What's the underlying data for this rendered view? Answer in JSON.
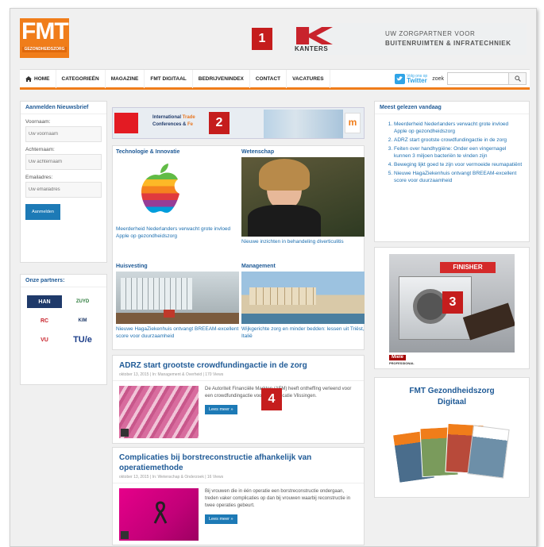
{
  "header": {
    "logo_text": "FMT",
    "logo_subtext": "GEZONDHEIDSZORG",
    "banner": {
      "brand": "KANTERS",
      "tagline_line1": "UW ZORGPARTNER VOOR",
      "tagline_line2": "BUITENRUIMTEN & INFRATECHNIEK"
    }
  },
  "markers": [
    "1",
    "2",
    "3",
    "4"
  ],
  "nav": {
    "items": [
      "HOME",
      "CATEGORIEËN",
      "MAGAZINE",
      "FMT DIGITAAL",
      "BEDRIJVENINDEX",
      "CONTACT",
      "VACATURES"
    ],
    "twitter_small": "Volg ons op",
    "twitter_big": "Twitter",
    "search_label": "zoek",
    "search_icon": "magnifier-icon"
  },
  "newsletter": {
    "title": "Aanmelden Nieuwsbrief",
    "fields": [
      {
        "label": "Voornaam:",
        "placeholder": "Uw voornaam"
      },
      {
        "label": "Achternaam:",
        "placeholder": "Uw achternaam"
      },
      {
        "label": "Emailadres:",
        "placeholder": "Uw emailadres"
      }
    ],
    "button": "Aanmelden"
  },
  "partners": {
    "title": "Onze partners:",
    "logos": [
      "HAN",
      "ZUYD",
      "RC",
      "KIM",
      "VU",
      "TU/e"
    ]
  },
  "banner2": {
    "text_line1_a": "International ",
    "text_line1_b": "Trade",
    "text_line2_a": "Conferences & ",
    "text_line2_b": "Fe",
    "logo": "m"
  },
  "grid": {
    "cells": [
      {
        "category": "Technologie & Innovatie",
        "text": "Meerderheid Nederlanders verwacht grote invloed Apple op gezondheidszorg"
      },
      {
        "category": "Wetenschap",
        "text": "Nieuwe inzichten in behandeling diverticulitis"
      },
      {
        "category": "Huisvesting",
        "text": "Nieuwe HagaZiekenhuis ontvangt BREEAM-excellent score voor duurzaamheid"
      },
      {
        "category": "Management",
        "text": "Wijkgerichte zorg en minder bedden: lessen uit Triëst, Italië"
      }
    ]
  },
  "articles": [
    {
      "title": "ADRZ start grootste crowdfundingactie in de zorg",
      "meta": "oktober 13, 2015  |  In: Management & Overheid  |  170 Views",
      "text": "De Autoriteit Financiële Markten (AFM) heeft ontheffing verleend voor een crowdfundingactie voor ADRZ locatie Vlissingen.",
      "button": "Lees meer »"
    },
    {
      "title": "Complicaties bij borstreconstructie afhankelijk van operatiemethode",
      "meta": "oktober 13, 2015  |  In: Wetenschap & Onderzoek  |  16 Views",
      "text": "Bij vrouwen die in één operatie een borstreconstructie ondergaan, treden vaker complicaties op dan bij vrouwen waarbij reconstructie in twee operaties gebeurt.",
      "button": "Lees meer »"
    }
  ],
  "mostread": {
    "title": "Meest gelezen vandaag",
    "items": [
      "Meerderheid Nederlanders verwacht grote invloed Apple op gezondheidszorg",
      "ADRZ start grootste crowdfundingactie in de zorg",
      "Feiten over handhygiëne: Onder een vingernagel kunnen 3 miljoen bacteriën te vinden zijn",
      "Beweging lijkt goed te zijn voor vermoeide reumapatiënt",
      "Nieuwe HagaZiekenhuis ontvangt BREEAM-excellent score voor duurzaamheid"
    ]
  },
  "ad": {
    "sign": "FINISHER",
    "brand": "Miele",
    "brand_sub": "PROFESSIONAL"
  },
  "fmt_digital": {
    "title_line1": "FMT Gezondheidszorg",
    "title_line2": "Digitaal"
  },
  "colors": {
    "accent": "#f07d1a",
    "link": "#1d6fb0",
    "heading": "#1f5a96",
    "marker": "#c51d1d",
    "button": "#1d7ab6"
  }
}
